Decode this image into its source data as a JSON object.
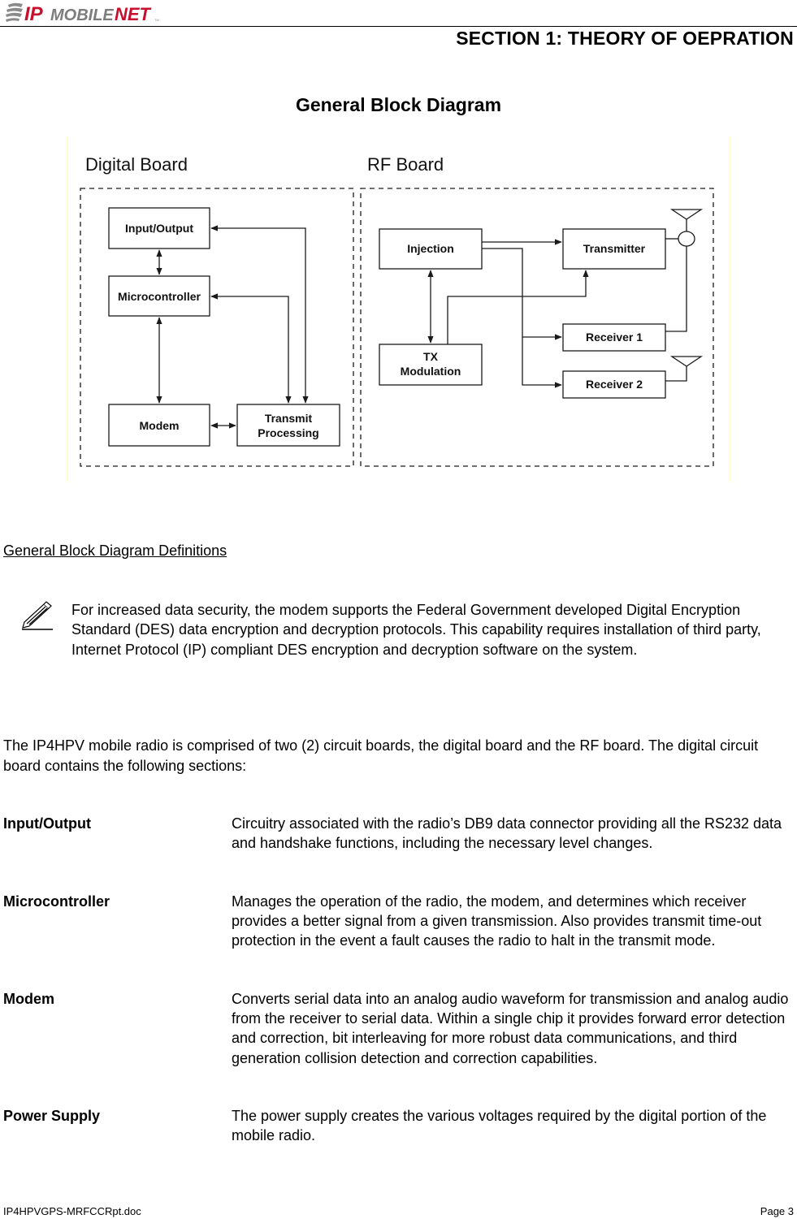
{
  "header": {
    "logo": {
      "part1": "IP",
      "part2": "MOBILE",
      "part3": "NET",
      "trademark": "TM"
    },
    "section_title": "SECTION 1:  THEORY OF OEPRATION"
  },
  "diagram": {
    "title": "General Block Diagram",
    "boards": [
      {
        "label": "Digital Board"
      },
      {
        "label": "RF Board"
      }
    ],
    "blocks": {
      "input_output": [
        "Input/Output"
      ],
      "microcontroller": [
        "Microcontroller"
      ],
      "modem": [
        "Modem"
      ],
      "transmit_processing": [
        "Transmit",
        "Processing"
      ],
      "injection": [
        "Injection"
      ],
      "tx_modulation": [
        "TX",
        "Modulation"
      ],
      "transmitter": [
        "Transmitter"
      ],
      "receiver1": [
        "Receiver 1"
      ],
      "receiver2": [
        "Receiver 2"
      ]
    },
    "colors": {
      "line": "#1a1a1a",
      "frame": "#ffff99"
    }
  },
  "definitions": {
    "heading": "General Block Diagram Definitions",
    "note": "For increased data security, the modem supports the Federal Government developed Digital Encryption Standard (DES) data encryption and decryption protocols.  This capability requires installation of third party, Internet Protocol (IP) compliant DES encryption and decryption software on the system.",
    "intro": "The IP4HPV mobile radio is comprised of two (2) circuit boards, the digital board and the RF board.  The digital circuit board contains the following sections:",
    "items": [
      {
        "term": "Input/Output",
        "description": "Circuitry associated with the radio’s DB9 data connector providing all the RS232 data and handshake functions, including the necessary level changes."
      },
      {
        "term": "Microcontroller",
        "description": "Manages the operation of the radio, the modem, and determines which receiver provides a better signal from a given transmission.  Also provides transmit time-out protection in the event a fault causes the radio to halt in the transmit mode."
      },
      {
        "term": "Modem",
        "description": "Converts serial data into an analog audio waveform for transmission and analog audio from the receiver to serial data.  Within a single chip it provides forward error detection and correction, bit interleaving for more robust data communications, and third generation collision detection and correction capabilities."
      },
      {
        "term": "Power Supply",
        "description": "The power supply creates the various voltages required by the digital portion of the mobile radio."
      }
    ]
  },
  "footer": {
    "filename": "IP4HPVGPS-MRFCCRpt.doc",
    "page": "Page 3"
  }
}
